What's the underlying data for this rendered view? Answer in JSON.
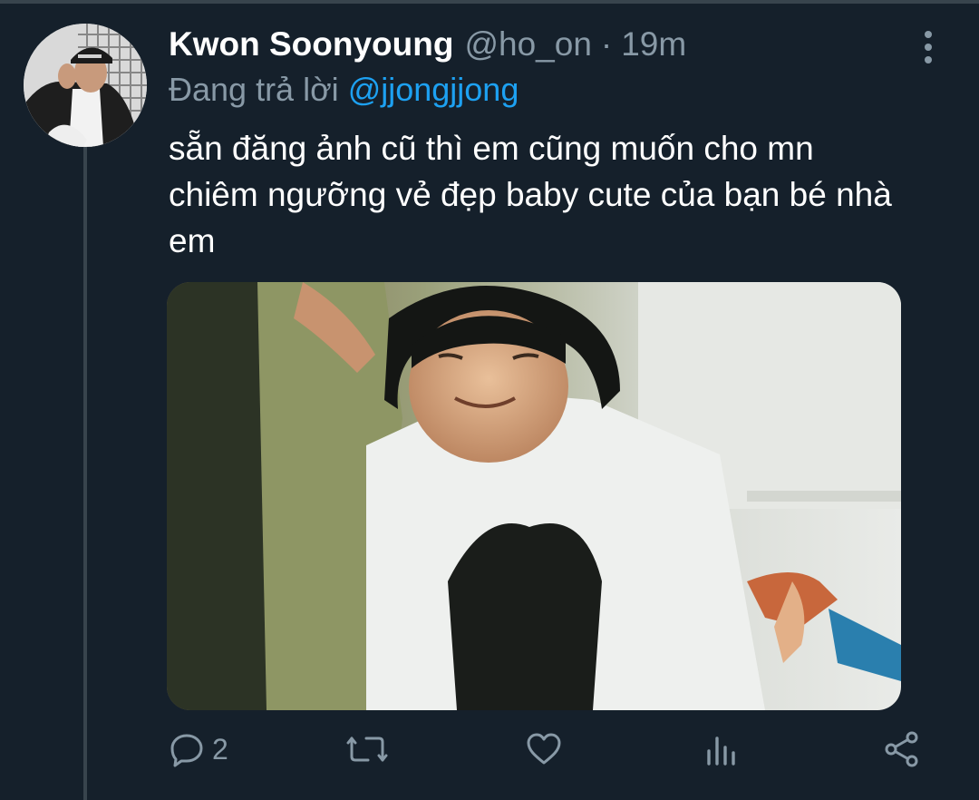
{
  "tweet": {
    "display_name": "Kwon Soonyoung",
    "handle": "@ho_on",
    "separator": "·",
    "time": "19m",
    "reply_prefix": "Đang trả lời",
    "reply_to": "@jjongjjong",
    "text_lines": [
      "sẵn đăng ảnh cũ thì em cũng muốn cho mn",
      "chiêm ngưỡng vẻ đẹp baby cute của bạn bé nhà",
      "em"
    ]
  },
  "actions": {
    "reply_count": "2",
    "icons": [
      "reply-icon",
      "retweet-icon",
      "like-icon",
      "analytics-icon",
      "share-icon"
    ]
  },
  "colors": {
    "background": "#15202b",
    "text_primary": "#ffffff",
    "text_secondary": "#8899a6",
    "accent": "#1da1f2",
    "divider": "#38444d"
  }
}
